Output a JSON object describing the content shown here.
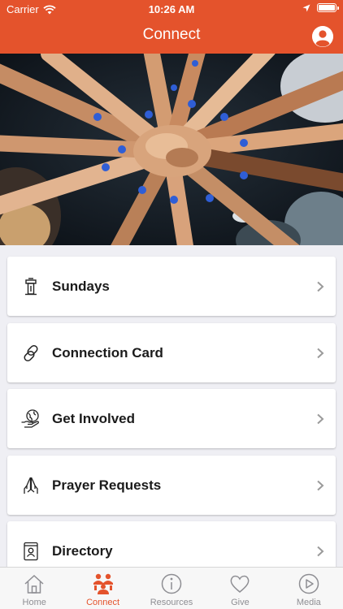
{
  "status_bar": {
    "carrier": "Carrier",
    "time": "10:26 AM",
    "icons": [
      "wifi-icon",
      "location-arrow-icon",
      "battery-icon"
    ]
  },
  "header": {
    "title": "Connect",
    "profile_icon": "user-avatar-icon",
    "background_color": "#e4532c"
  },
  "hero": {
    "subject": "hands stacked together"
  },
  "menu": {
    "items": [
      {
        "label": "Sundays",
        "icon": "pulpit-icon"
      },
      {
        "label": "Connection Card",
        "icon": "link-icon"
      },
      {
        "label": "Get Involved",
        "icon": "globe-hand-icon"
      },
      {
        "label": "Prayer Requests",
        "icon": "praying-hands-icon"
      },
      {
        "label": "Directory",
        "icon": "directory-book-icon"
      }
    ]
  },
  "tabbar": {
    "active": "Connect",
    "active_color": "#e4532c",
    "items": [
      {
        "label": "Home",
        "icon": "home-icon"
      },
      {
        "label": "Connect",
        "icon": "people-icon"
      },
      {
        "label": "Resources",
        "icon": "info-icon"
      },
      {
        "label": "Give",
        "icon": "heart-icon"
      },
      {
        "label": "Media",
        "icon": "play-icon"
      }
    ]
  }
}
